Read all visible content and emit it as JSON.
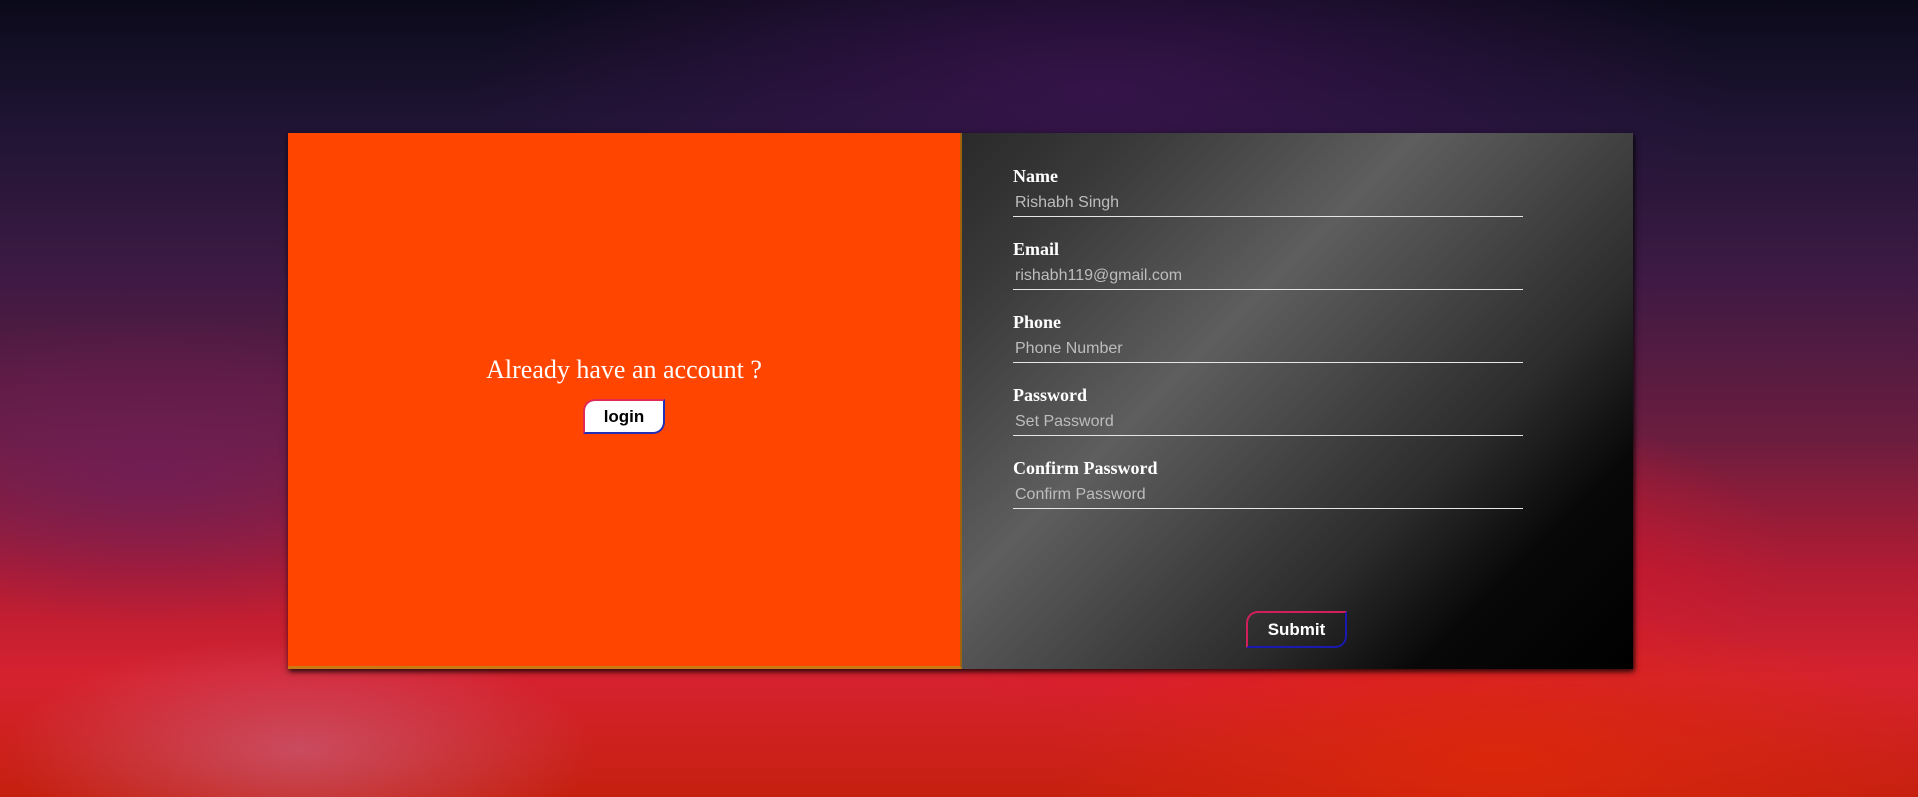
{
  "left": {
    "heading": "Already have an account ?",
    "login_label": "login"
  },
  "form": {
    "fields": [
      {
        "label": "Name",
        "placeholder": "Rishabh Singh",
        "value": ""
      },
      {
        "label": "Email",
        "placeholder": "rishabh119@gmail.com",
        "value": ""
      },
      {
        "label": "Phone",
        "placeholder": "Phone Number",
        "value": ""
      },
      {
        "label": "Password",
        "placeholder": "Set Password",
        "value": ""
      },
      {
        "label": "Confirm Password",
        "placeholder": "Confirm Password",
        "value": ""
      }
    ],
    "submit_label": "Submit"
  },
  "colors": {
    "left_panel": "#ff4500",
    "button_border_primary": "#2230b8",
    "button_border_accent": "#e02a55"
  }
}
